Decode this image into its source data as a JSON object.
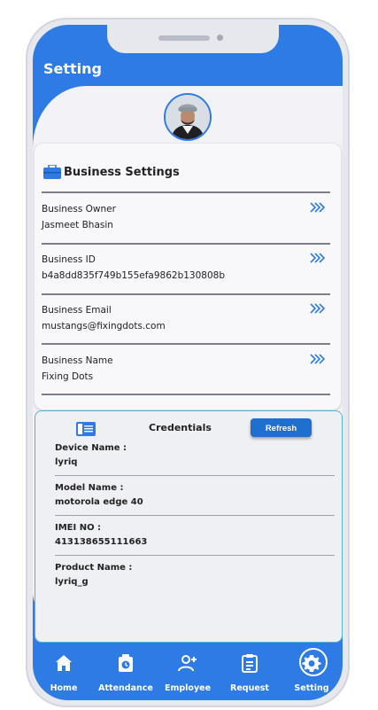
{
  "screen": {
    "title": "Setting"
  },
  "business": {
    "heading": "Business Settings",
    "rows": [
      {
        "label": "Business Owner",
        "value": "Jasmeet Bhasin"
      },
      {
        "label": "Business ID",
        "value": "b4a8dd835f749b155efa9862b130808b"
      },
      {
        "label": "Business Email",
        "value": "mustangs@fixingdots.com"
      },
      {
        "label": "Business Name",
        "value": "Fixing Dots"
      }
    ]
  },
  "credentials": {
    "heading": "Credentials",
    "refresh_label": "Refresh",
    "rows": [
      {
        "label": "Device Name :",
        "value": "lyriq"
      },
      {
        "label": "Model Name :",
        "value": "motorola edge 40"
      },
      {
        "label": "IMEI NO :",
        "value": "413138655111663"
      },
      {
        "label": "Product Name :",
        "value": "lyriq_g"
      }
    ]
  },
  "nav": {
    "items": [
      {
        "label": "Home",
        "icon": "home-icon"
      },
      {
        "label": "Attendance",
        "icon": "attendance-icon"
      },
      {
        "label": "Employee",
        "icon": "add-user-icon"
      },
      {
        "label": "Request",
        "icon": "request-icon"
      },
      {
        "label": "Setting",
        "icon": "gear-icon",
        "active": true
      }
    ]
  },
  "colors": {
    "primary": "#2e7be5",
    "button": "#1f6fd1",
    "background": "#f3f3f7"
  }
}
